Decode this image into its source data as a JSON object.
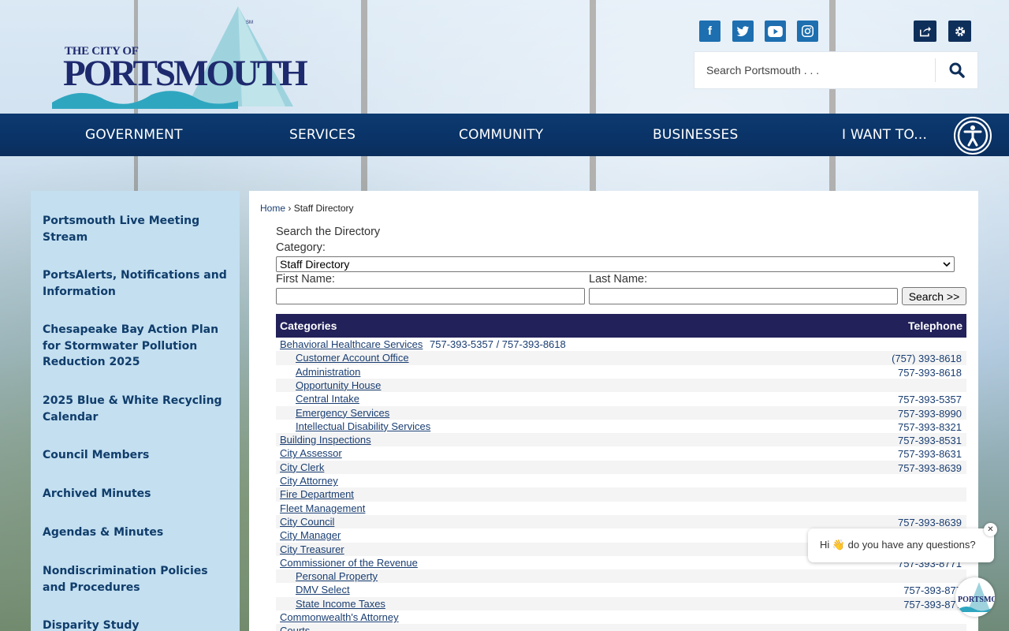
{
  "header": {
    "logo": {
      "line1": "THE CITY OF",
      "line2": "PORTSMOUTH",
      "mark": "SM"
    },
    "social": [
      {
        "name": "facebook",
        "glyph": "f"
      },
      {
        "name": "twitter",
        "glyph": "t"
      },
      {
        "name": "youtube",
        "glyph": "▶"
      },
      {
        "name": "instagram",
        "glyph": "◎"
      }
    ],
    "search": {
      "placeholder": "Search Portsmouth . . ."
    }
  },
  "nav": {
    "items": [
      "GOVERNMENT",
      "SERVICES",
      "COMMUNITY",
      "BUSINESSES",
      "I WANT TO..."
    ]
  },
  "sidebar": {
    "items": [
      "Portsmouth Live Meeting Stream",
      "PortsAlerts, Notifications and Information",
      "Chesapeake Bay Action Plan for Stormwater Pollution Reduction 2025",
      "2025 Blue & White Recycling Calendar",
      "Council Members",
      "Archived Minutes",
      "Agendas & Minutes",
      "Nondiscrimination Policies and Procedures",
      "Disparity Study"
    ]
  },
  "main": {
    "breadcrumb": {
      "home": "Home",
      "sep": "›",
      "current": "Staff Directory"
    },
    "form": {
      "heading": "Search the Directory",
      "category_label": "Category:",
      "category_value": "Staff Directory",
      "first_label": "First Name:",
      "last_label": "Last Name:",
      "search_button": "Search >>"
    },
    "table": {
      "col_categories": "Categories",
      "col_telephone": "Telephone",
      "rows": [
        {
          "name": "Behavioral Healthcare Services",
          "note": "757-393-5357 / 757-393-8618",
          "phone": "",
          "indent": false
        },
        {
          "name": "Customer Account Office",
          "note": "",
          "phone": "(757) 393-8618",
          "indent": true
        },
        {
          "name": "Administration",
          "note": "",
          "phone": "757-393-8618",
          "indent": true
        },
        {
          "name": "Opportunity House",
          "note": "",
          "phone": "",
          "indent": true
        },
        {
          "name": "Central Intake",
          "note": "",
          "phone": "757-393-5357",
          "indent": true
        },
        {
          "name": "Emergency Services",
          "note": "",
          "phone": "757-393-8990",
          "indent": true
        },
        {
          "name": "Intellectual Disability Services",
          "note": "",
          "phone": "757-393-8321",
          "indent": true
        },
        {
          "name": "Building Inspections",
          "note": "",
          "phone": "757-393-8531",
          "indent": false
        },
        {
          "name": "City Assessor",
          "note": "",
          "phone": "757-393-8631",
          "indent": false
        },
        {
          "name": "City Clerk",
          "note": "",
          "phone": "757-393-8639",
          "indent": false
        },
        {
          "name": "City Attorney",
          "note": "",
          "phone": "",
          "indent": false
        },
        {
          "name": "Fire Department",
          "note": "",
          "phone": "",
          "indent": false
        },
        {
          "name": "Fleet Management",
          "note": "",
          "phone": "",
          "indent": false
        },
        {
          "name": "City Council",
          "note": "",
          "phone": "757-393-8639",
          "indent": false
        },
        {
          "name": "City Manager",
          "note": "",
          "phone": "",
          "indent": false
        },
        {
          "name": "City Treasurer",
          "note": "",
          "phone": "",
          "indent": false
        },
        {
          "name": "Commissioner of the Revenue",
          "note": "",
          "phone": "757-393-8771",
          "indent": false
        },
        {
          "name": "Personal Property",
          "note": "",
          "phone": "",
          "indent": true
        },
        {
          "name": "DMV Select",
          "note": "",
          "phone": "757-393-877",
          "indent": true
        },
        {
          "name": "State Income Taxes",
          "note": "",
          "phone": "757-393-877",
          "indent": true
        },
        {
          "name": "Commonwealth's Attorney",
          "note": "",
          "phone": "",
          "indent": false
        },
        {
          "name": "Courts",
          "note": "",
          "phone": "",
          "indent": false
        }
      ]
    }
  },
  "chat": {
    "message": "Hi 👋 do you have any questions?",
    "close": "✕",
    "avatar_label": "PORTSMOUTH"
  },
  "colors": {
    "nav": "#0a3367",
    "sidebar": "#c3dff0",
    "table_header": "#22215a",
    "link": "#1a3e72",
    "social": "#1d6fb0"
  }
}
